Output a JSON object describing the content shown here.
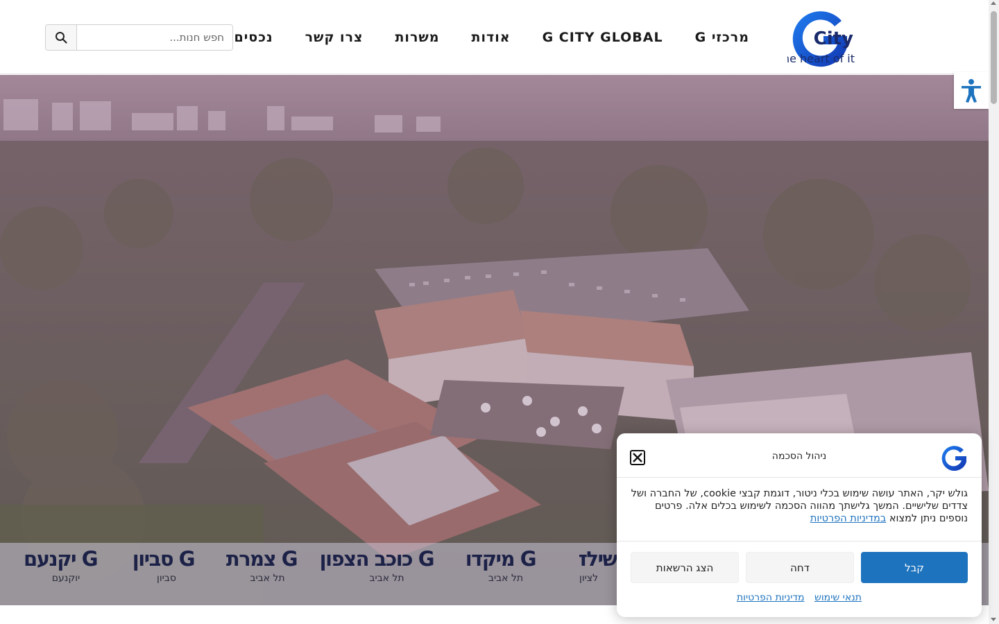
{
  "header": {
    "logo": {
      "word": "City",
      "tagline": "The heart of it."
    },
    "nav": [
      {
        "label": "מרכזי G"
      },
      {
        "label": "G CITY GLOBAL"
      },
      {
        "label": "אודות"
      },
      {
        "label": "משרות"
      },
      {
        "label": "צרו קשר"
      },
      {
        "label": "נכסים בפיתוח"
      }
    ],
    "search": {
      "placeholder": "חפש חנות...",
      "value": ""
    }
  },
  "centers": [
    {
      "name": "G יקנעם",
      "city": "יוקנעם"
    },
    {
      "name": "G סביון",
      "city": "סביון"
    },
    {
      "name": "G צמרת",
      "city": "תל אביב"
    },
    {
      "name": "G כוכב הצפון",
      "city": "תל אביב"
    },
    {
      "name": "G מיקדו",
      "city": "תל אביב"
    },
    {
      "name": "שילד",
      "city": "לציון"
    }
  ],
  "consent": {
    "title": "ניהול הסכמה",
    "body_text": "גולש יקר, האתר עושה שימוש בכלי ניטור, דוגמת קבצי cookie, של החברה ושל צדדים שלישיים. המשך גלישתך מהווה הסכמה לשימוש בכלים אלה. פרטים נוספים ניתן למצוא",
    "body_link": "במדיניות הפרטיות",
    "buttons": {
      "accept": "קבל",
      "deny": "דחה",
      "preferences": "הצג הרשאות"
    },
    "links": {
      "terms": "תנאי שימוש",
      "privacy": "מדיניות הפרטיות"
    }
  },
  "colors": {
    "brand_blue": "#1e73be",
    "logo_blue": "#1546c8",
    "center_text": "#1c2147",
    "nav_text": "#1a1a1a"
  }
}
